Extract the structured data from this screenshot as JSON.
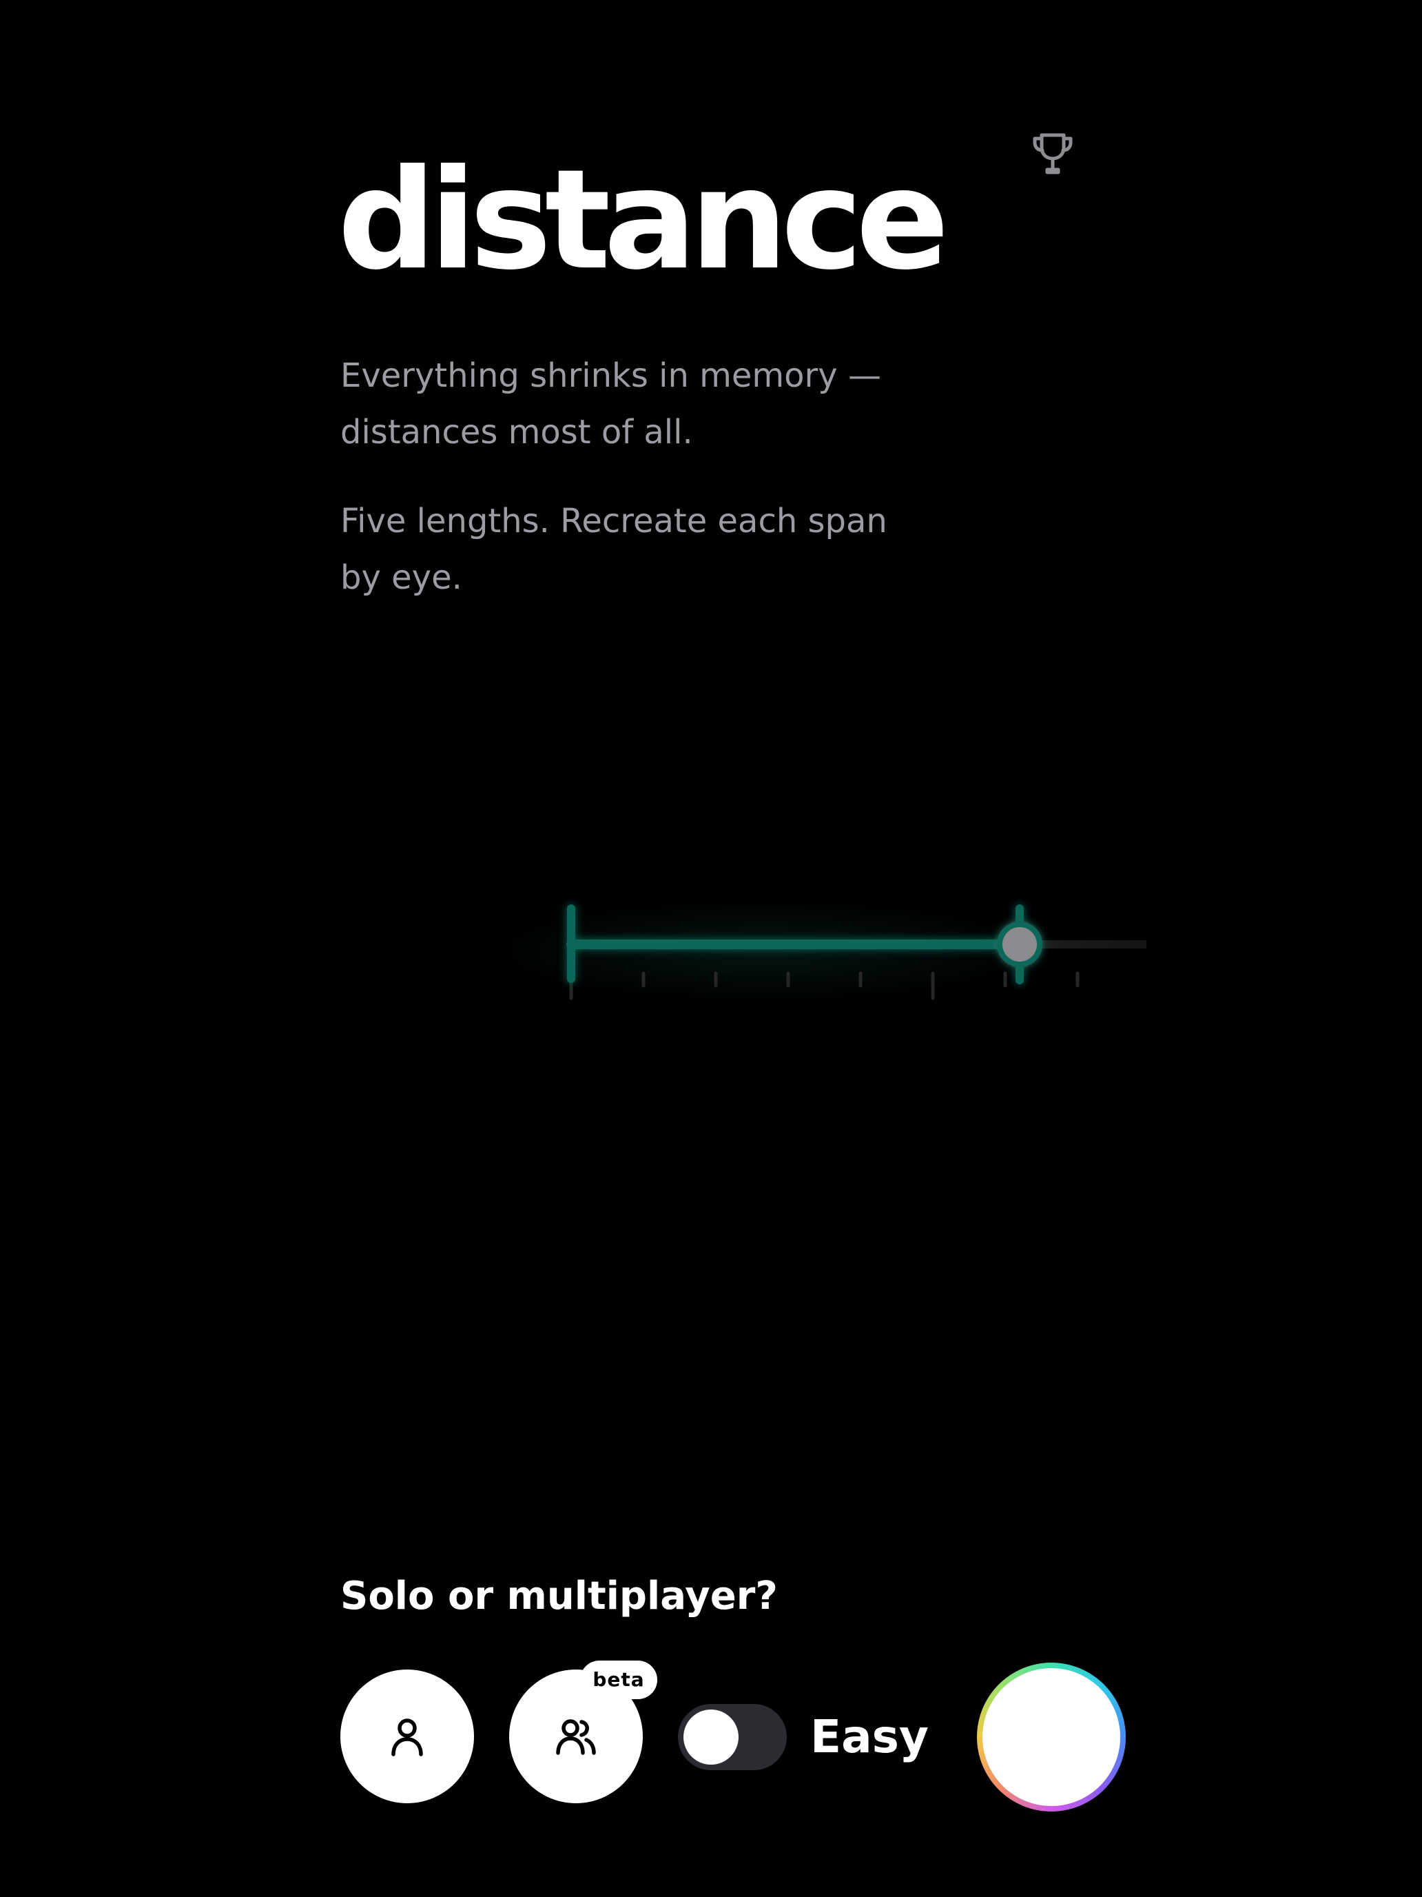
{
  "header": {
    "icon": "trophy-icon",
    "title": "distance"
  },
  "intro": {
    "paragraph1": "Everything shrinks in memory — distances most of all.",
    "paragraph2": "Five lengths. Recreate each span by eye."
  },
  "slider": {
    "value_fraction": 0.78,
    "accent_color": "#10685a",
    "handle_color": "#8c8c90"
  },
  "mode": {
    "question": "Solo or multiplayer?",
    "solo_icon": "person-icon",
    "multi_icon": "people-icon",
    "beta_badge": "beta",
    "toggle_label": "Easy",
    "toggle_on": false
  },
  "start": {
    "icon": "gradient-ring"
  }
}
